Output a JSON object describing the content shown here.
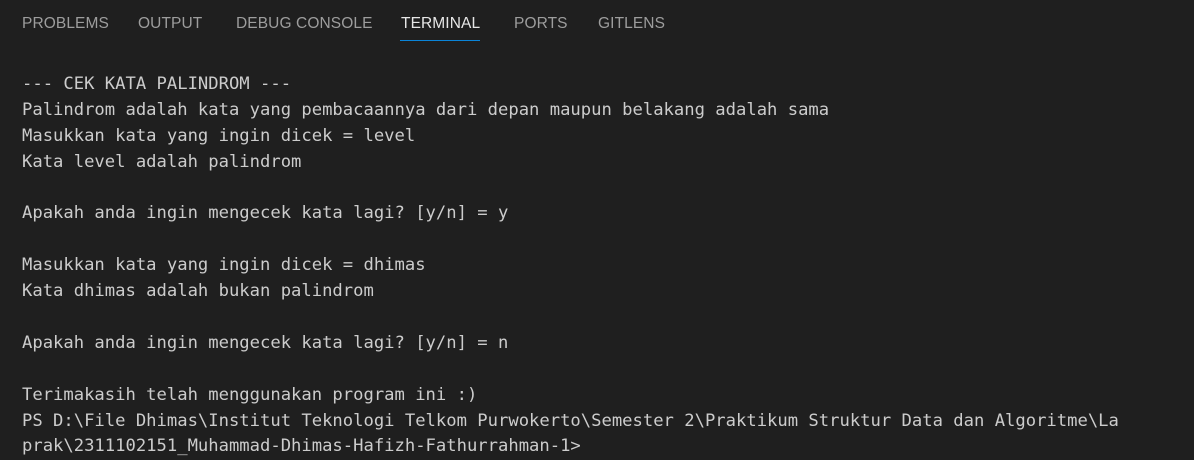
{
  "tabs": [
    {
      "label": "PROBLEMS",
      "active": false
    },
    {
      "label": "OUTPUT",
      "active": false
    },
    {
      "label": "DEBUG CONSOLE",
      "active": false
    },
    {
      "label": "TERMINAL",
      "active": true
    },
    {
      "label": "PORTS",
      "active": false
    },
    {
      "label": "GITLENS",
      "active": false
    }
  ],
  "terminal": {
    "lines": [
      "--- CEK KATA PALINDROM ---",
      "Palindrom adalah kata yang pembacaannya dari depan maupun belakang adalah sama",
      "Masukkan kata yang ingin dicek = level",
      "Kata level adalah palindrom",
      "",
      "Apakah anda ingin mengecek kata lagi? [y/n] = y",
      "",
      "Masukkan kata yang ingin dicek = dhimas",
      "Kata dhimas adalah bukan palindrom",
      "",
      "Apakah anda ingin mengecek kata lagi? [y/n] = n",
      "",
      "Terimakasih telah menggunakan program ini :)",
      "PS D:\\File Dhimas\\Institut Teknologi Telkom Purwokerto\\Semester 2\\Praktikum Struktur Data dan Algoritme\\La",
      "prak\\2311102151_Muhammad-Dhimas-Hafizh-Fathurrahman-1>"
    ]
  },
  "colors": {
    "background": "#1f1f1f",
    "tab_inactive": "#9d9d9d",
    "tab_active": "#e7e7e7",
    "tab_underline": "#0a84d8",
    "terminal_text": "#cccccc"
  }
}
